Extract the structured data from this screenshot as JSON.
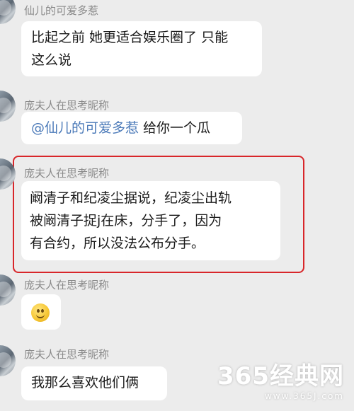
{
  "messages": [
    {
      "sender": "仙儿的可爱多惹",
      "lines": [
        "比起之前 她更适合娱乐圈了 只能",
        "这么说"
      ]
    },
    {
      "sender": "庞夫人在思考昵称",
      "mention": "@仙儿的可爱多惹",
      "text": " 给你一个瓜"
    },
    {
      "sender": "庞夫人在思考昵称",
      "lines": [
        "阚清子和纪凌尘据说，纪凌尘出轨",
        "被阚清子捉j在床，分手了，因为",
        "有合约，所以没法公布分手。"
      ]
    },
    {
      "sender": "庞夫人在思考昵称",
      "emoji": "smile-emoji"
    },
    {
      "sender": "庞夫人在思考昵称",
      "text": "我那么喜欢他们俩"
    }
  ],
  "highlight_color": "#d8262a",
  "watermark": {
    "big": "365经典网",
    "small": "www.365J.com"
  }
}
